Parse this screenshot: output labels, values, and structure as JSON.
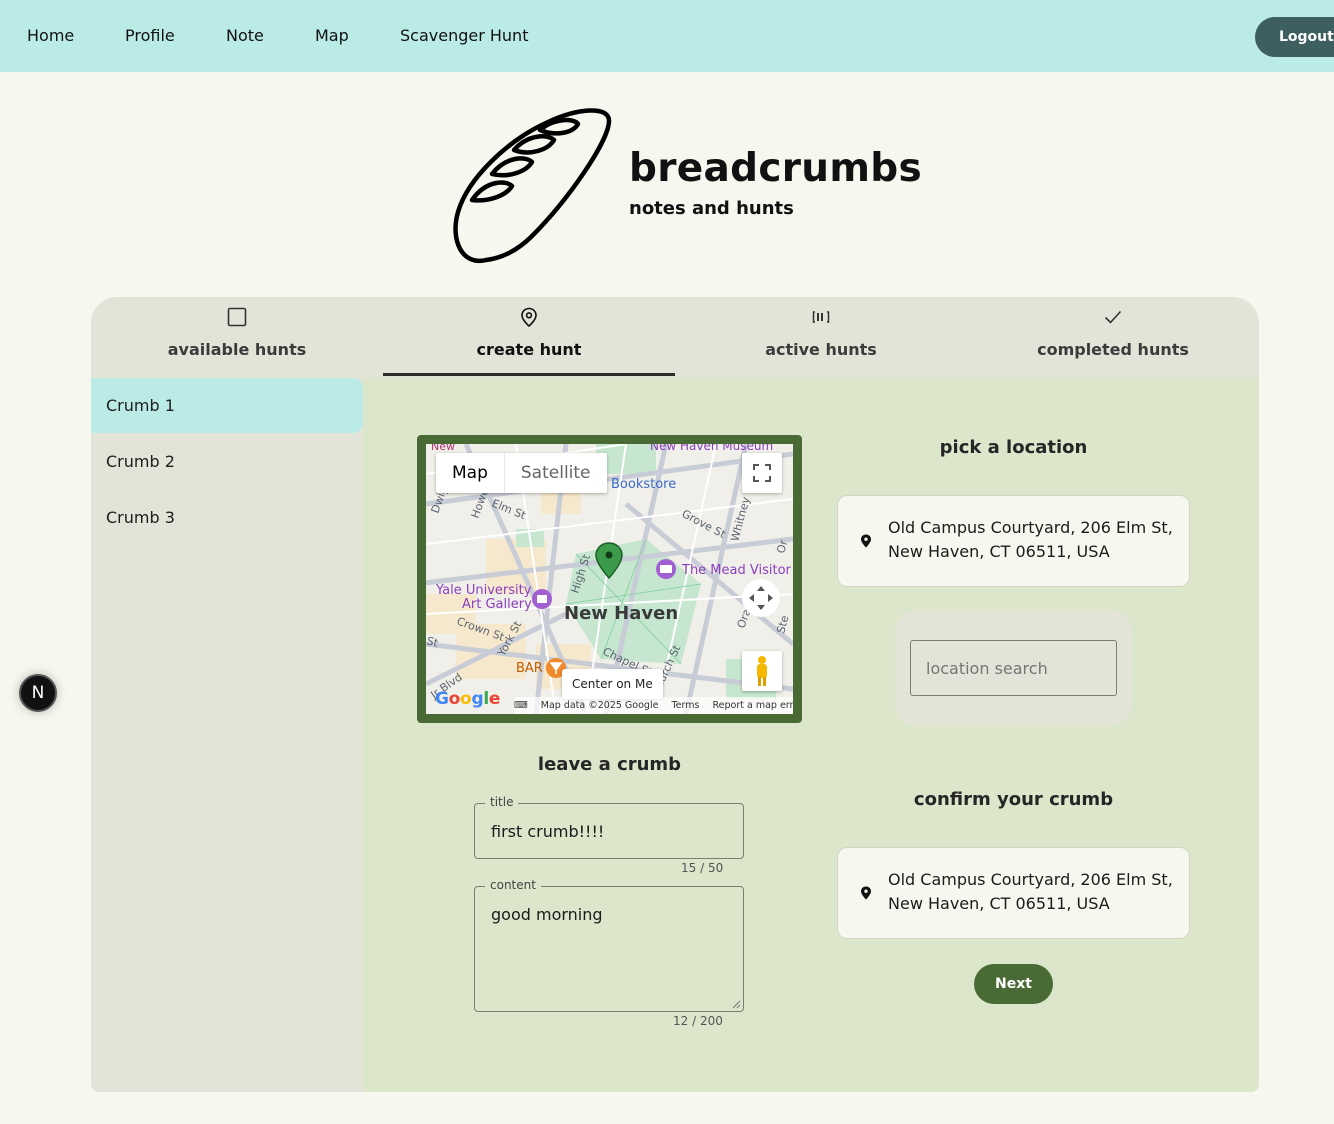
{
  "nav": {
    "links": [
      "Home",
      "Profile",
      "Note",
      "Map",
      "Scavenger Hunt"
    ],
    "logout_label": "Logout"
  },
  "brand": {
    "title": "breadcrumbs",
    "subtitle": "notes and hunts"
  },
  "tabs": [
    {
      "label": "available hunts",
      "icon": "square-icon"
    },
    {
      "label": "create hunt",
      "icon": "map-pin-icon",
      "active": true
    },
    {
      "label": "active hunts",
      "icon": "progress-icon"
    },
    {
      "label": "completed hunts",
      "icon": "check-icon"
    }
  ],
  "sidebar": {
    "items": [
      "Crumb 1",
      "Crumb 2",
      "Crumb 3"
    ],
    "active_index": 0
  },
  "map": {
    "type_buttons": [
      "Map",
      "Satellite"
    ],
    "center_label": "Center on Me",
    "city_label": "New Haven",
    "place_labels": [
      "New Haven Museum",
      "Bookstore",
      "The Mead Visitor",
      "Yale University",
      "Art Gallery",
      "BAR",
      "New"
    ],
    "street_labels": [
      "Elm St",
      "Howe St",
      "Grove St",
      "Whitney",
      "High St",
      "Crown St",
      "York St",
      "Chapel St",
      "Church St",
      "Jr Blvd",
      "Orange",
      "St",
      "Dwig",
      "Ora",
      "Or",
      "Ste"
    ],
    "footer": {
      "data": "Map data ©2025 Google",
      "terms": "Terms",
      "report": "Report a map error"
    },
    "logo_text": "Google"
  },
  "leave_crumb": {
    "heading": "leave a crumb",
    "title_label": "title",
    "title_value": "first crumb!!!!",
    "title_counter": "15 / 50",
    "content_label": "content",
    "content_value": "good morning",
    "content_counter": "12 / 200"
  },
  "pick_location": {
    "heading": "pick a location",
    "address": "Old Campus Courtyard, 206 Elm St, New Haven, CT 06511, USA",
    "search_placeholder": "location search"
  },
  "confirm": {
    "heading": "confirm your crumb",
    "address": "Old Campus Courtyard, 206 Elm St, New Haven, CT 06511, USA",
    "next_label": "Next"
  },
  "dev_badge": "N",
  "colors": {
    "nav_bg": "#bbebe7",
    "accent": "#4a6a35",
    "logout_bg": "#3d5f5f",
    "panel_bg": "#e2e4d8",
    "content_bg": "#dbe6cb",
    "page_bg": "#f6f7ef"
  }
}
